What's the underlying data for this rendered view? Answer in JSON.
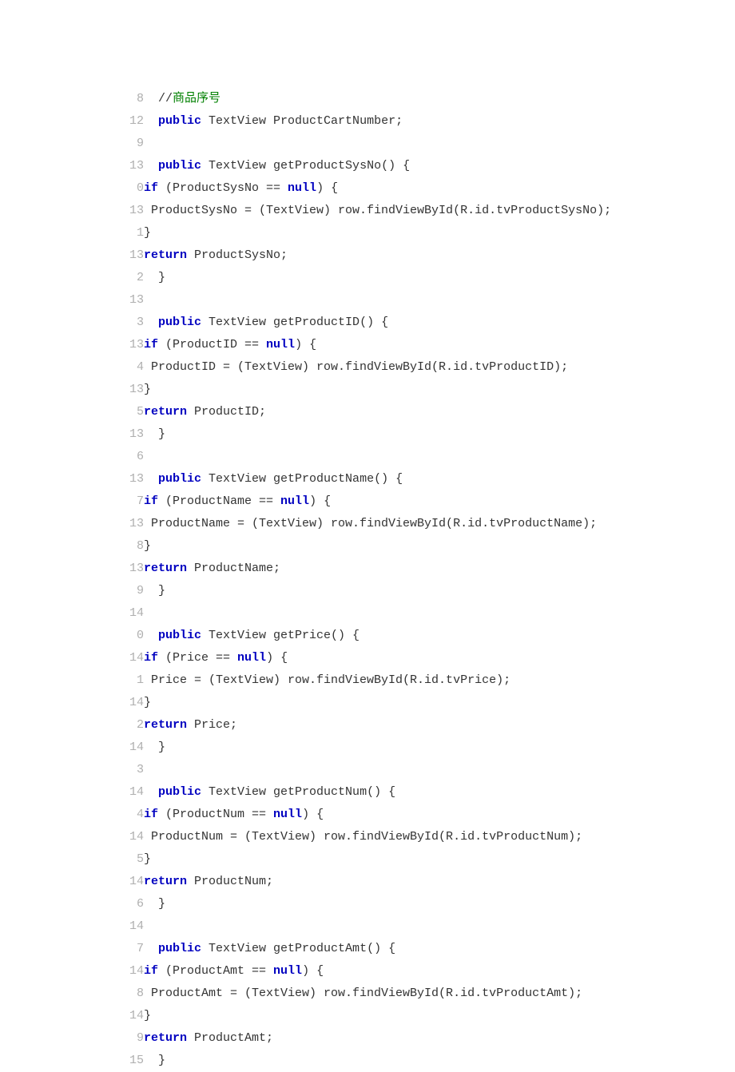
{
  "lines": [
    {
      "num": "8",
      "tokens": [
        {
          "t": "  //",
          "c": "cm"
        },
        {
          "t": "商品序号",
          "c": "cm-cn"
        }
      ]
    },
    {
      "num": "12",
      "tokens": [
        {
          "t": "  ",
          "c": ""
        },
        {
          "t": "public",
          "c": "kw"
        },
        {
          "t": " TextView ProductCartNumber;",
          "c": ""
        }
      ]
    },
    {
      "num": "9",
      "tokens": [
        {
          "t": "",
          "c": ""
        }
      ]
    },
    {
      "num": "13",
      "tokens": [
        {
          "t": "  ",
          "c": ""
        },
        {
          "t": "public",
          "c": "kw"
        },
        {
          "t": " TextView getProductSysNo() {",
          "c": ""
        }
      ]
    },
    {
      "num": "0",
      "tokens": [
        {
          "t": "if",
          "c": "kw"
        },
        {
          "t": " (ProductSysNo == ",
          "c": ""
        },
        {
          "t": "null",
          "c": "kw"
        },
        {
          "t": ") {",
          "c": ""
        }
      ]
    },
    {
      "num": "13",
      "tokens": [
        {
          "t": " ProductSysNo = (TextView) row.findViewById(R.id.tvProductSysNo);",
          "c": ""
        }
      ]
    },
    {
      "num": "1",
      "tokens": [
        {
          "t": "}",
          "c": ""
        }
      ]
    },
    {
      "num": "13",
      "tokens": [
        {
          "t": "return",
          "c": "kw"
        },
        {
          "t": " ProductSysNo;",
          "c": ""
        }
      ]
    },
    {
      "num": "2",
      "tokens": [
        {
          "t": "  }",
          "c": ""
        }
      ]
    },
    {
      "num": "13",
      "tokens": [
        {
          "t": "",
          "c": ""
        }
      ]
    },
    {
      "num": "3",
      "tokens": [
        {
          "t": "  ",
          "c": ""
        },
        {
          "t": "public",
          "c": "kw"
        },
        {
          "t": " TextView getProductID() {",
          "c": ""
        }
      ]
    },
    {
      "num": "13",
      "tokens": [
        {
          "t": "if",
          "c": "kw"
        },
        {
          "t": " (ProductID == ",
          "c": ""
        },
        {
          "t": "null",
          "c": "kw"
        },
        {
          "t": ") {",
          "c": ""
        }
      ]
    },
    {
      "num": "4",
      "tokens": [
        {
          "t": " ProductID = (TextView) row.findViewById(R.id.tvProductID);",
          "c": ""
        }
      ]
    },
    {
      "num": "13",
      "tokens": [
        {
          "t": "}",
          "c": ""
        }
      ]
    },
    {
      "num": "5",
      "tokens": [
        {
          "t": "return",
          "c": "kw"
        },
        {
          "t": " ProductID;",
          "c": ""
        }
      ]
    },
    {
      "num": "13",
      "tokens": [
        {
          "t": "  }",
          "c": ""
        }
      ]
    },
    {
      "num": "6",
      "tokens": [
        {
          "t": "",
          "c": ""
        }
      ]
    },
    {
      "num": "13",
      "tokens": [
        {
          "t": "  ",
          "c": ""
        },
        {
          "t": "public",
          "c": "kw"
        },
        {
          "t": " TextView getProductName() {",
          "c": ""
        }
      ]
    },
    {
      "num": "7",
      "tokens": [
        {
          "t": "if",
          "c": "kw"
        },
        {
          "t": " (ProductName == ",
          "c": ""
        },
        {
          "t": "null",
          "c": "kw"
        },
        {
          "t": ") {",
          "c": ""
        }
      ]
    },
    {
      "num": "13",
      "tokens": [
        {
          "t": " ProductName = (TextView) row.findViewById(R.id.tvProductName);",
          "c": ""
        }
      ]
    },
    {
      "num": "8",
      "tokens": [
        {
          "t": "}",
          "c": ""
        }
      ]
    },
    {
      "num": "13",
      "tokens": [
        {
          "t": "return",
          "c": "kw"
        },
        {
          "t": " ProductName;",
          "c": ""
        }
      ]
    },
    {
      "num": "9",
      "tokens": [
        {
          "t": "  }",
          "c": ""
        }
      ]
    },
    {
      "num": "14",
      "tokens": [
        {
          "t": "",
          "c": ""
        }
      ]
    },
    {
      "num": "0",
      "tokens": [
        {
          "t": "  ",
          "c": ""
        },
        {
          "t": "public",
          "c": "kw"
        },
        {
          "t": " TextView getPrice() {",
          "c": ""
        }
      ]
    },
    {
      "num": "14",
      "tokens": [
        {
          "t": "if",
          "c": "kw"
        },
        {
          "t": " (Price == ",
          "c": ""
        },
        {
          "t": "null",
          "c": "kw"
        },
        {
          "t": ") {",
          "c": ""
        }
      ]
    },
    {
      "num": "1",
      "tokens": [
        {
          "t": " Price = (TextView) row.findViewById(R.id.tvPrice);",
          "c": ""
        }
      ]
    },
    {
      "num": "14",
      "tokens": [
        {
          "t": "}",
          "c": ""
        }
      ]
    },
    {
      "num": "2",
      "tokens": [
        {
          "t": "return",
          "c": "kw"
        },
        {
          "t": " Price;",
          "c": ""
        }
      ]
    },
    {
      "num": "14",
      "tokens": [
        {
          "t": "  }",
          "c": ""
        }
      ]
    },
    {
      "num": "3",
      "tokens": [
        {
          "t": "",
          "c": ""
        }
      ]
    },
    {
      "num": "14",
      "tokens": [
        {
          "t": "  ",
          "c": ""
        },
        {
          "t": "public",
          "c": "kw"
        },
        {
          "t": " TextView getProductNum() {",
          "c": ""
        }
      ]
    },
    {
      "num": "4",
      "tokens": [
        {
          "t": "if",
          "c": "kw"
        },
        {
          "t": " (ProductNum == ",
          "c": ""
        },
        {
          "t": "null",
          "c": "kw"
        },
        {
          "t": ") {",
          "c": ""
        }
      ]
    },
    {
      "num": "14",
      "tokens": [
        {
          "t": " ProductNum = (TextView) row.findViewById(R.id.tvProductNum);",
          "c": ""
        }
      ]
    },
    {
      "num": "5",
      "tokens": [
        {
          "t": "}",
          "c": ""
        }
      ]
    },
    {
      "num": "14",
      "tokens": [
        {
          "t": "return",
          "c": "kw"
        },
        {
          "t": " ProductNum;",
          "c": ""
        }
      ]
    },
    {
      "num": "6",
      "tokens": [
        {
          "t": "  }",
          "c": ""
        }
      ]
    },
    {
      "num": "14",
      "tokens": [
        {
          "t": "",
          "c": ""
        }
      ]
    },
    {
      "num": "7",
      "tokens": [
        {
          "t": "  ",
          "c": ""
        },
        {
          "t": "public",
          "c": "kw"
        },
        {
          "t": " TextView getProductAmt() {",
          "c": ""
        }
      ]
    },
    {
      "num": "14",
      "tokens": [
        {
          "t": "if",
          "c": "kw"
        },
        {
          "t": " (ProductAmt == ",
          "c": ""
        },
        {
          "t": "null",
          "c": "kw"
        },
        {
          "t": ") {",
          "c": ""
        }
      ]
    },
    {
      "num": "8",
      "tokens": [
        {
          "t": " ProductAmt = (TextView) row.findViewById(R.id.tvProductAmt);",
          "c": ""
        }
      ]
    },
    {
      "num": "14",
      "tokens": [
        {
          "t": "}",
          "c": ""
        }
      ]
    },
    {
      "num": "9",
      "tokens": [
        {
          "t": "return",
          "c": "kw"
        },
        {
          "t": " ProductAmt;",
          "c": ""
        }
      ]
    },
    {
      "num": "15",
      "tokens": [
        {
          "t": "  }",
          "c": ""
        }
      ]
    }
  ]
}
